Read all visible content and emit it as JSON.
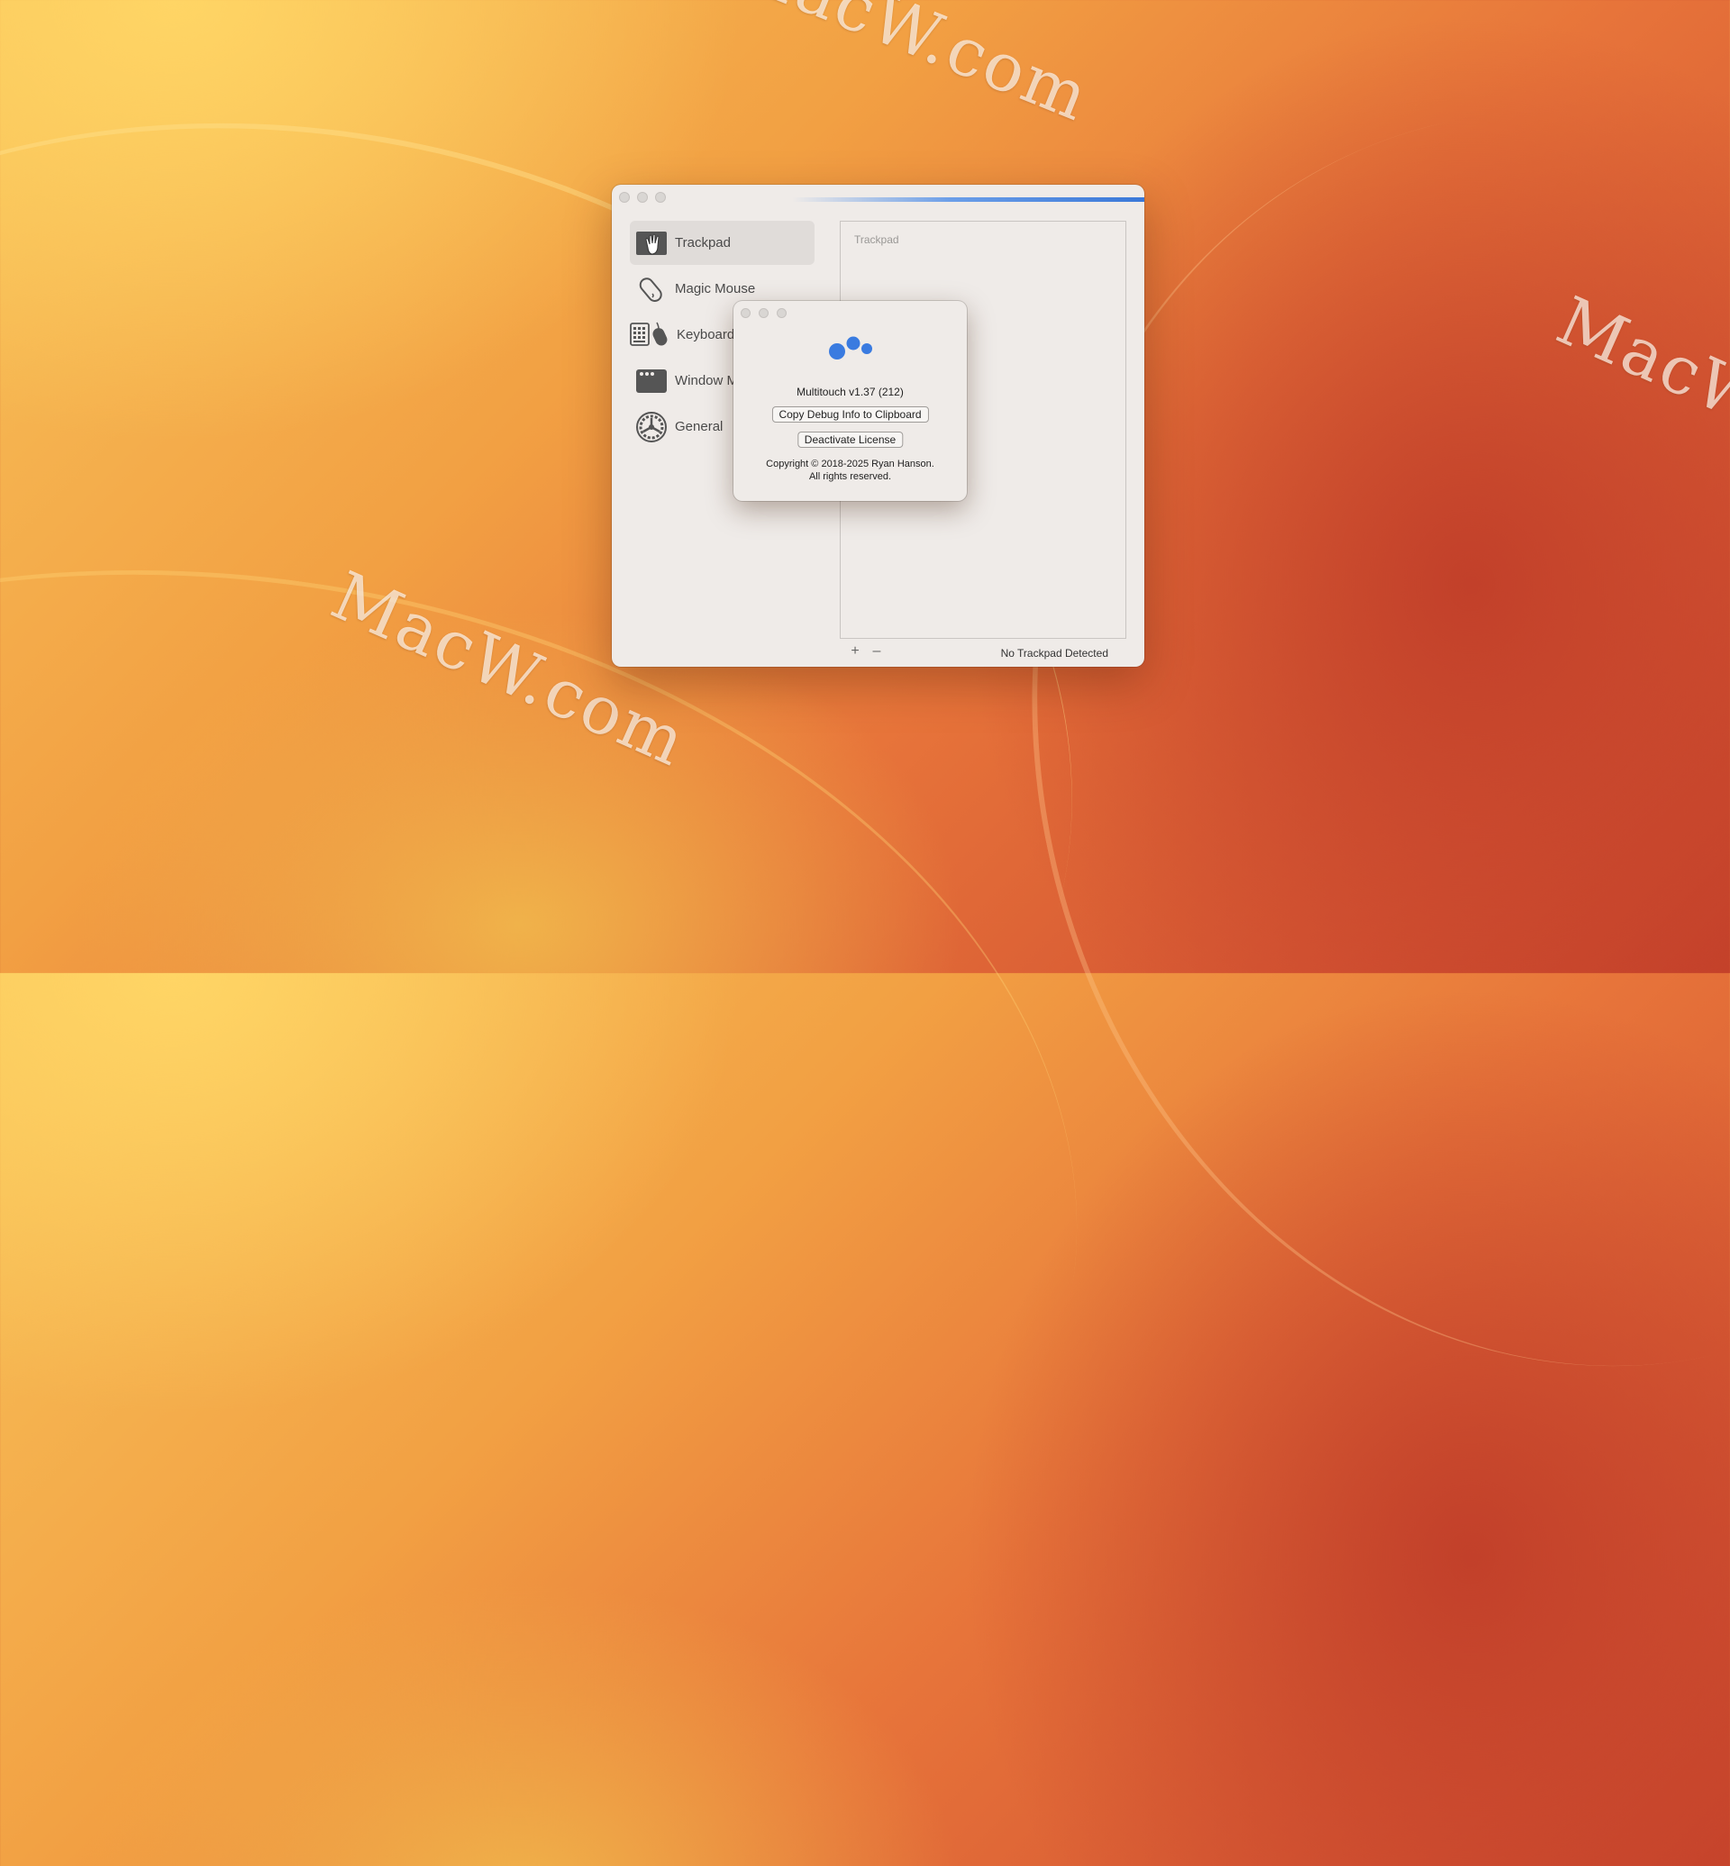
{
  "desktop": {
    "watermarks": [
      "MacW.com",
      "MacW.com",
      "MacW.com"
    ]
  },
  "main_window": {
    "sidebar": {
      "items": [
        {
          "label": "Trackpad",
          "icon": "trackpad-hand-icon",
          "selected": true
        },
        {
          "label": "Magic Mouse",
          "icon": "magic-mouse-icon",
          "selected": false
        },
        {
          "label": "Keyboard",
          "icon": "keyboard-mouse-icon",
          "selected": false
        },
        {
          "label": "Window M",
          "icon": "window-icon",
          "selected": false
        },
        {
          "label": "General",
          "icon": "gear-icon",
          "selected": false
        }
      ]
    },
    "panel": {
      "title": "Trackpad"
    },
    "footer": {
      "add_label": "+",
      "remove_label": "–",
      "status": "No Trackpad Detected"
    }
  },
  "about_dialog": {
    "version": "Multitouch v1.37 (212)",
    "copy_debug_label": "Copy Debug Info to Clipboard",
    "deactivate_label": "Deactivate License",
    "copyright_line1": "Copyright © 2018-2025 Ryan Hanson.",
    "copyright_line2": "All rights reserved."
  },
  "colors": {
    "accent_blue": "#3a7be0",
    "window_bg": "#efebe8"
  }
}
